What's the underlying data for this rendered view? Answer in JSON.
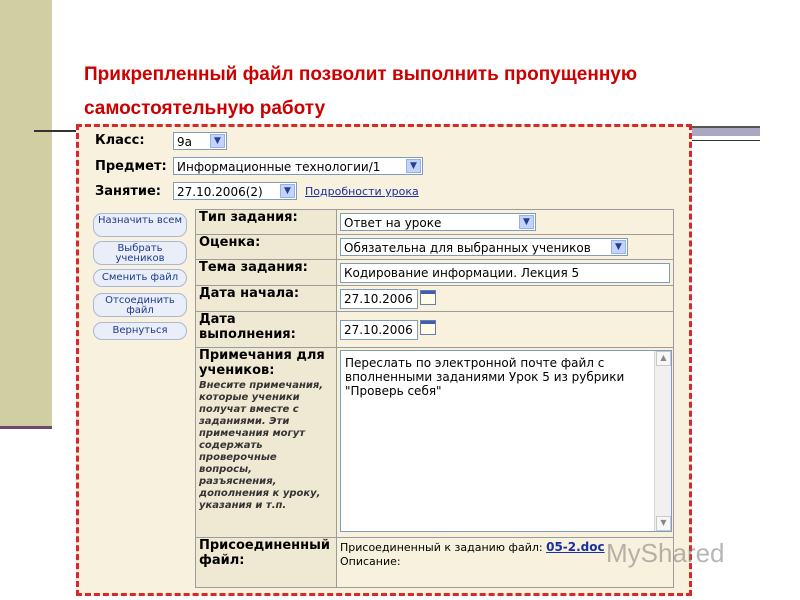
{
  "slide": {
    "title": "Прикрепленный файл позволит выполнить пропущенную самостоятельную работу"
  },
  "header": {
    "class_label": "Класс:",
    "class_value": "9а",
    "subject_label": "Предмет:",
    "subject_value": "Информационные технологии/1",
    "lesson_label": "Занятие:",
    "lesson_value": "27.10.2006(2)",
    "lesson_details_link": "Подробности урока"
  },
  "buttons": [
    {
      "label": "Назначить всем"
    },
    {
      "label": "Выбрать учеников"
    },
    {
      "label": "Сменить файл"
    },
    {
      "label": "Отсоединить файл"
    },
    {
      "label": "Вернуться"
    }
  ],
  "form": {
    "task_type_label": "Тип задания:",
    "task_type_value": "Ответ на уроке",
    "grade_label": "Оценка:",
    "grade_value": "Обязательна для выбранных учеников",
    "topic_label": "Тема задания:",
    "topic_value": "Кодирование информации. Лекция 5",
    "start_label": "Дата начала:",
    "start_value": "27.10.2006",
    "due_label": "Дата выполнения:",
    "due_value": "27.10.2006",
    "notes_label": "Примечания для учеников:",
    "notes_hint": "Внесите примечания, которые ученики получат вместе с заданиями. Эти примечания могут содержать проверочные вопросы, разъяснения, дополнения к уроку, указания и т.п.",
    "notes_value": "Переслать по электронной почте файл с вполненными заданиями  Урок 5 из рубрики \"Проверь себя\"",
    "attached_label": "Присоединенный файл:",
    "attached_text": "Присоединенный к заданию файл:",
    "attached_file": "05-2.doc",
    "description_label": "Описание:"
  },
  "watermark": "MyShared",
  "colors": {
    "title": "#cc0000",
    "panel_border": "#d42a2a",
    "panel_bg": "#f7f1dd",
    "left_bar": "#cfcfa3",
    "link": "#1a2fa0"
  }
}
